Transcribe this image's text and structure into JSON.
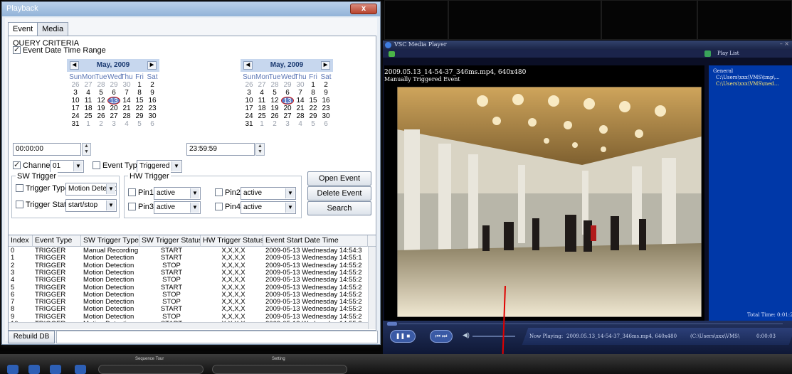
{
  "playback_window": {
    "title": "Playback",
    "close_label": "x",
    "tabs": [
      "Event",
      "Media"
    ],
    "query_criteria": {
      "group_label": "QUERY CRITERIA",
      "event_date_time_range_label": "Event Date Time Range",
      "event_date_time_range_checked": true,
      "start_calendar": {
        "month_label": "May, 2009",
        "day_headers": [
          "Sun",
          "Mon",
          "Tue",
          "Wed",
          "Thu",
          "Fri",
          "Sat"
        ],
        "days": [
          "26",
          "27",
          "28",
          "29",
          "30",
          "1",
          "2",
          "3",
          "4",
          "5",
          "6",
          "7",
          "8",
          "9",
          "10",
          "11",
          "12",
          "13",
          "14",
          "15",
          "16",
          "17",
          "18",
          "19",
          "20",
          "21",
          "22",
          "23",
          "24",
          "25",
          "26",
          "27",
          "28",
          "29",
          "30",
          "31",
          "1",
          "2",
          "3",
          "4",
          "5",
          "6"
        ],
        "selected_day": "13"
      },
      "end_calendar": {
        "month_label": "May, 2009",
        "day_headers": [
          "Sun",
          "Mon",
          "Tue",
          "Wed",
          "Thu",
          "Fri",
          "Sat"
        ],
        "days": [
          "26",
          "27",
          "28",
          "29",
          "30",
          "1",
          "2",
          "3",
          "4",
          "5",
          "6",
          "7",
          "8",
          "9",
          "10",
          "11",
          "12",
          "13",
          "14",
          "15",
          "16",
          "17",
          "18",
          "19",
          "20",
          "21",
          "22",
          "23",
          "24",
          "25",
          "26",
          "27",
          "28",
          "29",
          "30",
          "31",
          "1",
          "2",
          "3",
          "4",
          "5",
          "6"
        ],
        "selected_day": "13"
      },
      "start_time": "00:00:00",
      "end_time": "23:59:59",
      "channel_label": "Channel",
      "channel_checked": true,
      "channel_value": "01",
      "event_type_label": "Event Type",
      "event_type_checked": false,
      "event_type_value": "Triggered",
      "sw_trigger": {
        "group_label": "SW Trigger",
        "trigger_type_label": "Trigger Type",
        "trigger_type_value": "Motion Detectio",
        "trigger_status_label": "Trigger Status",
        "trigger_status_value": "start/stop"
      },
      "hw_trigger": {
        "group_label": "HW Trigger",
        "pin1_label": "Pin1",
        "pin1_value": "active",
        "pin2_label": "Pin2",
        "pin2_value": "active",
        "pin3_label": "Pin3",
        "pin3_value": "active",
        "pin4_label": "Pin4",
        "pin4_value": "active"
      },
      "open_event_label": "Open Event",
      "delete_event_label": "Delete Event",
      "search_label": "Search"
    },
    "results_table": {
      "columns": [
        "Index",
        "Event Type",
        "SW Trigger Type",
        "SW Trigger Status",
        "HW Trigger Status",
        "Event Start Date Time"
      ],
      "rows": [
        [
          "0",
          "TRIGGER",
          "Manual Recording",
          "START",
          "X,X,X,X",
          "2009-05-13 Wednesday 14:54:3"
        ],
        [
          "1",
          "TRIGGER",
          "Motion Detection",
          "START",
          "X,X,X,X",
          "2009-05-13 Wednesday 14:55:1"
        ],
        [
          "2",
          "TRIGGER",
          "Motion Detection",
          "STOP",
          "X,X,X,X",
          "2009-05-13 Wednesday 14:55:2"
        ],
        [
          "3",
          "TRIGGER",
          "Motion Detection",
          "START",
          "X,X,X,X",
          "2009-05-13 Wednesday 14:55:2"
        ],
        [
          "4",
          "TRIGGER",
          "Motion Detection",
          "STOP",
          "X,X,X,X",
          "2009-05-13 Wednesday 14:55:2"
        ],
        [
          "5",
          "TRIGGER",
          "Motion Detection",
          "START",
          "X,X,X,X",
          "2009-05-13 Wednesday 14:55:2"
        ],
        [
          "6",
          "TRIGGER",
          "Motion Detection",
          "STOP",
          "X,X,X,X",
          "2009-05-13 Wednesday 14:55:2"
        ],
        [
          "7",
          "TRIGGER",
          "Motion Detection",
          "STOP",
          "X,X,X,X",
          "2009-05-13 Wednesday 14:55:2"
        ],
        [
          "8",
          "TRIGGER",
          "Motion Detection",
          "START",
          "X,X,X,X",
          "2009-05-13 Wednesday 14:55:2"
        ],
        [
          "9",
          "TRIGGER",
          "Motion Detection",
          "STOP",
          "X,X,X,X",
          "2009-05-13 Wednesday 14:55:2"
        ],
        [
          "10",
          "TRIGGER",
          "Motion Detection",
          "START",
          "X,X,X,X",
          "2009-05-13 Wednesday 14:55:2"
        ]
      ]
    },
    "rebuild_db_label": "Rebuild DB"
  },
  "media_player": {
    "title": "VSC Media Player",
    "video_overlay_line1": "2009.05.13_14-54-37_346ms.mp4,  640x480",
    "video_overlay_line2": "Manually  Triggered  Event",
    "play_list": {
      "header": "Play List",
      "group": "General",
      "items": [
        "C:\\Users\\xxx\\VMS\\tmp\\...",
        "C:\\Users\\xxx\\VMS\\med..."
      ],
      "total_time": "Total  Time:  0:01:2"
    },
    "status": {
      "now_playing_label": "Now  Playing:",
      "file": "2009.05.13_14-54-37_346ms.mp4,  640x480",
      "path": "(C:\\Users\\xxx\\VMS\\",
      "time": "0:00:03"
    }
  },
  "taskbar": {
    "sequence_tour_label": "Sequence Tour",
    "setting_label": "Setting"
  },
  "colors": {
    "accent_red": "#e00000",
    "playlist_blue": "#0038a8",
    "selected_day_ring": "#c81a1a"
  }
}
